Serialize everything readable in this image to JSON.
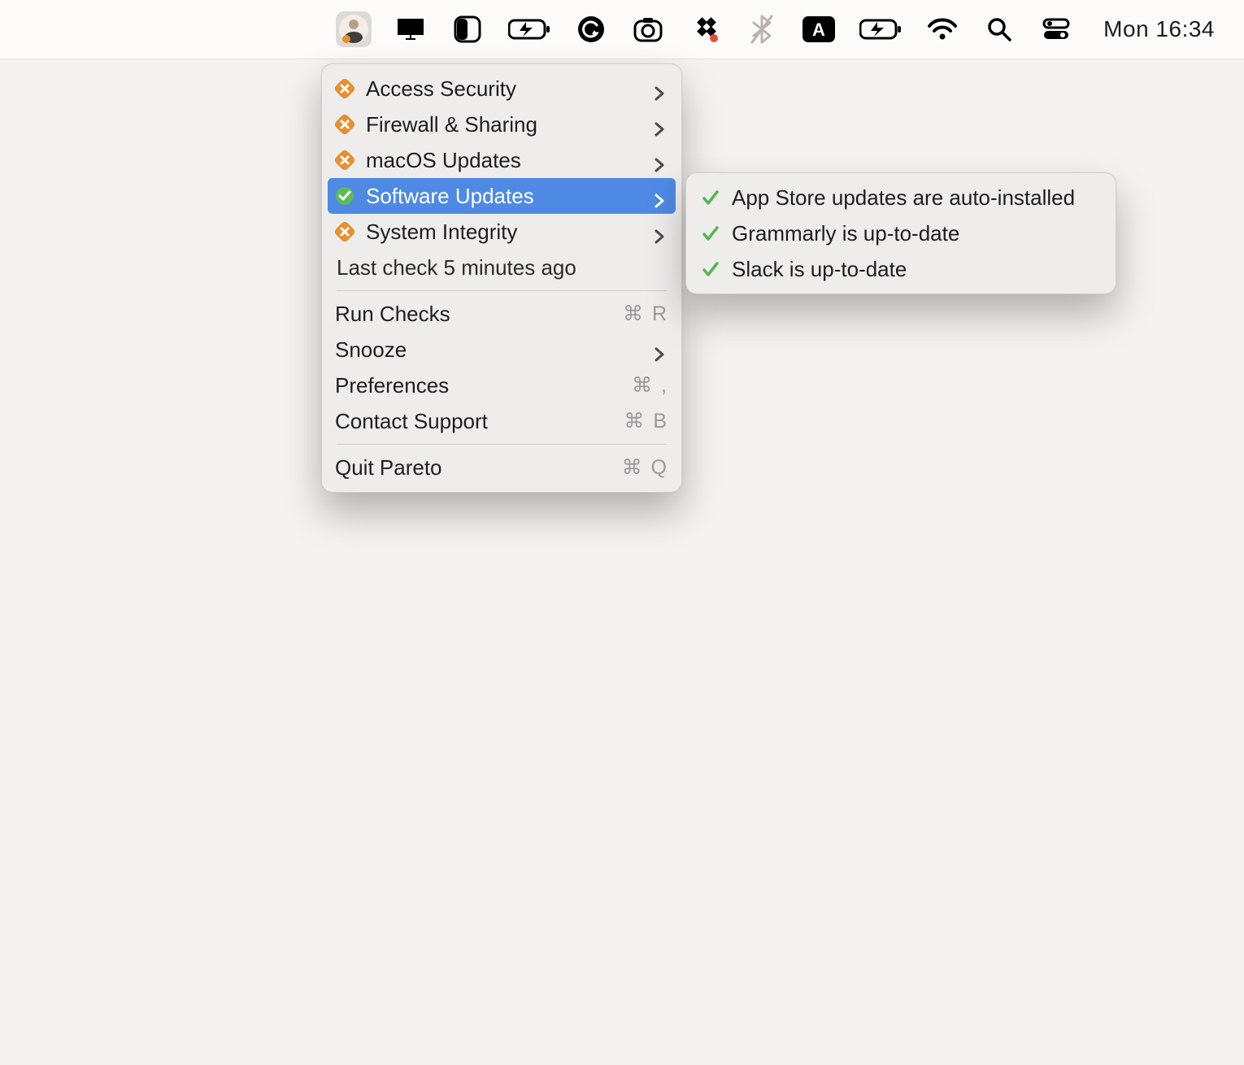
{
  "menubar": {
    "clock": "Mon 16:34"
  },
  "menu": {
    "items": [
      {
        "label": "Access Security",
        "badge": "warn",
        "chevron": true
      },
      {
        "label": "Firewall & Sharing",
        "badge": "warn",
        "chevron": true
      },
      {
        "label": "macOS Updates",
        "badge": "warn",
        "chevron": true
      },
      {
        "label": "Software Updates",
        "badge": "ok",
        "chevron": true,
        "highlighted": true
      },
      {
        "label": "System Integrity",
        "badge": "warn",
        "chevron": true
      }
    ],
    "last_check": "Last check 5 minutes ago",
    "actions": {
      "run_checks": {
        "label": "Run Checks",
        "shortcut": "⌘ R"
      },
      "snooze": {
        "label": "Snooze",
        "chevron": true
      },
      "preferences": {
        "label": "Preferences",
        "shortcut": "⌘ ,"
      },
      "contact": {
        "label": "Contact Support",
        "shortcut": "⌘ B"
      },
      "quit": {
        "label": "Quit Pareto",
        "shortcut": "⌘ Q"
      }
    }
  },
  "submenu": {
    "items": [
      {
        "label": "App Store updates are auto-installed"
      },
      {
        "label": "Grammarly is up-to-date"
      },
      {
        "label": "Slack is up-to-date"
      }
    ]
  }
}
